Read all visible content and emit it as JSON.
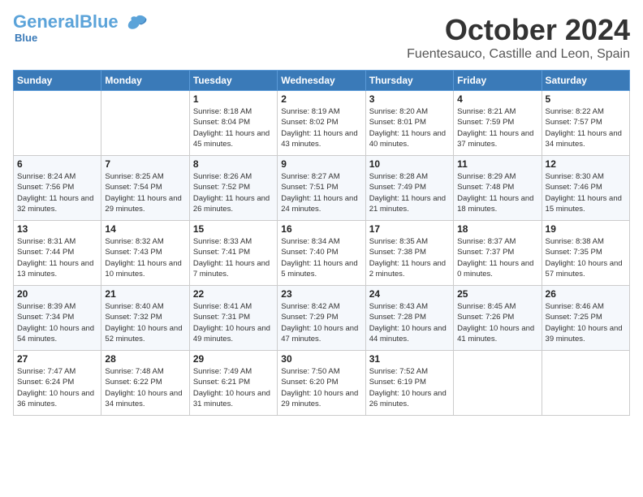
{
  "header": {
    "logo_general": "General",
    "logo_blue": "Blue",
    "month": "October 2024",
    "location": "Fuentesauco, Castille and Leon, Spain"
  },
  "weekdays": [
    "Sunday",
    "Monday",
    "Tuesday",
    "Wednesday",
    "Thursday",
    "Friday",
    "Saturday"
  ],
  "weeks": [
    [
      {
        "day": "",
        "sunrise": "",
        "sunset": "",
        "daylight": ""
      },
      {
        "day": "",
        "sunrise": "",
        "sunset": "",
        "daylight": ""
      },
      {
        "day": "1",
        "sunrise": "Sunrise: 8:18 AM",
        "sunset": "Sunset: 8:04 PM",
        "daylight": "Daylight: 11 hours and 45 minutes."
      },
      {
        "day": "2",
        "sunrise": "Sunrise: 8:19 AM",
        "sunset": "Sunset: 8:02 PM",
        "daylight": "Daylight: 11 hours and 43 minutes."
      },
      {
        "day": "3",
        "sunrise": "Sunrise: 8:20 AM",
        "sunset": "Sunset: 8:01 PM",
        "daylight": "Daylight: 11 hours and 40 minutes."
      },
      {
        "day": "4",
        "sunrise": "Sunrise: 8:21 AM",
        "sunset": "Sunset: 7:59 PM",
        "daylight": "Daylight: 11 hours and 37 minutes."
      },
      {
        "day": "5",
        "sunrise": "Sunrise: 8:22 AM",
        "sunset": "Sunset: 7:57 PM",
        "daylight": "Daylight: 11 hours and 34 minutes."
      }
    ],
    [
      {
        "day": "6",
        "sunrise": "Sunrise: 8:24 AM",
        "sunset": "Sunset: 7:56 PM",
        "daylight": "Daylight: 11 hours and 32 minutes."
      },
      {
        "day": "7",
        "sunrise": "Sunrise: 8:25 AM",
        "sunset": "Sunset: 7:54 PM",
        "daylight": "Daylight: 11 hours and 29 minutes."
      },
      {
        "day": "8",
        "sunrise": "Sunrise: 8:26 AM",
        "sunset": "Sunset: 7:52 PM",
        "daylight": "Daylight: 11 hours and 26 minutes."
      },
      {
        "day": "9",
        "sunrise": "Sunrise: 8:27 AM",
        "sunset": "Sunset: 7:51 PM",
        "daylight": "Daylight: 11 hours and 24 minutes."
      },
      {
        "day": "10",
        "sunrise": "Sunrise: 8:28 AM",
        "sunset": "Sunset: 7:49 PM",
        "daylight": "Daylight: 11 hours and 21 minutes."
      },
      {
        "day": "11",
        "sunrise": "Sunrise: 8:29 AM",
        "sunset": "Sunset: 7:48 PM",
        "daylight": "Daylight: 11 hours and 18 minutes."
      },
      {
        "day": "12",
        "sunrise": "Sunrise: 8:30 AM",
        "sunset": "Sunset: 7:46 PM",
        "daylight": "Daylight: 11 hours and 15 minutes."
      }
    ],
    [
      {
        "day": "13",
        "sunrise": "Sunrise: 8:31 AM",
        "sunset": "Sunset: 7:44 PM",
        "daylight": "Daylight: 11 hours and 13 minutes."
      },
      {
        "day": "14",
        "sunrise": "Sunrise: 8:32 AM",
        "sunset": "Sunset: 7:43 PM",
        "daylight": "Daylight: 11 hours and 10 minutes."
      },
      {
        "day": "15",
        "sunrise": "Sunrise: 8:33 AM",
        "sunset": "Sunset: 7:41 PM",
        "daylight": "Daylight: 11 hours and 7 minutes."
      },
      {
        "day": "16",
        "sunrise": "Sunrise: 8:34 AM",
        "sunset": "Sunset: 7:40 PM",
        "daylight": "Daylight: 11 hours and 5 minutes."
      },
      {
        "day": "17",
        "sunrise": "Sunrise: 8:35 AM",
        "sunset": "Sunset: 7:38 PM",
        "daylight": "Daylight: 11 hours and 2 minutes."
      },
      {
        "day": "18",
        "sunrise": "Sunrise: 8:37 AM",
        "sunset": "Sunset: 7:37 PM",
        "daylight": "Daylight: 11 hours and 0 minutes."
      },
      {
        "day": "19",
        "sunrise": "Sunrise: 8:38 AM",
        "sunset": "Sunset: 7:35 PM",
        "daylight": "Daylight: 10 hours and 57 minutes."
      }
    ],
    [
      {
        "day": "20",
        "sunrise": "Sunrise: 8:39 AM",
        "sunset": "Sunset: 7:34 PM",
        "daylight": "Daylight: 10 hours and 54 minutes."
      },
      {
        "day": "21",
        "sunrise": "Sunrise: 8:40 AM",
        "sunset": "Sunset: 7:32 PM",
        "daylight": "Daylight: 10 hours and 52 minutes."
      },
      {
        "day": "22",
        "sunrise": "Sunrise: 8:41 AM",
        "sunset": "Sunset: 7:31 PM",
        "daylight": "Daylight: 10 hours and 49 minutes."
      },
      {
        "day": "23",
        "sunrise": "Sunrise: 8:42 AM",
        "sunset": "Sunset: 7:29 PM",
        "daylight": "Daylight: 10 hours and 47 minutes."
      },
      {
        "day": "24",
        "sunrise": "Sunrise: 8:43 AM",
        "sunset": "Sunset: 7:28 PM",
        "daylight": "Daylight: 10 hours and 44 minutes."
      },
      {
        "day": "25",
        "sunrise": "Sunrise: 8:45 AM",
        "sunset": "Sunset: 7:26 PM",
        "daylight": "Daylight: 10 hours and 41 minutes."
      },
      {
        "day": "26",
        "sunrise": "Sunrise: 8:46 AM",
        "sunset": "Sunset: 7:25 PM",
        "daylight": "Daylight: 10 hours and 39 minutes."
      }
    ],
    [
      {
        "day": "27",
        "sunrise": "Sunrise: 7:47 AM",
        "sunset": "Sunset: 6:24 PM",
        "daylight": "Daylight: 10 hours and 36 minutes."
      },
      {
        "day": "28",
        "sunrise": "Sunrise: 7:48 AM",
        "sunset": "Sunset: 6:22 PM",
        "daylight": "Daylight: 10 hours and 34 minutes."
      },
      {
        "day": "29",
        "sunrise": "Sunrise: 7:49 AM",
        "sunset": "Sunset: 6:21 PM",
        "daylight": "Daylight: 10 hours and 31 minutes."
      },
      {
        "day": "30",
        "sunrise": "Sunrise: 7:50 AM",
        "sunset": "Sunset: 6:20 PM",
        "daylight": "Daylight: 10 hours and 29 minutes."
      },
      {
        "day": "31",
        "sunrise": "Sunrise: 7:52 AM",
        "sunset": "Sunset: 6:19 PM",
        "daylight": "Daylight: 10 hours and 26 minutes."
      },
      {
        "day": "",
        "sunrise": "",
        "sunset": "",
        "daylight": ""
      },
      {
        "day": "",
        "sunrise": "",
        "sunset": "",
        "daylight": ""
      }
    ]
  ]
}
